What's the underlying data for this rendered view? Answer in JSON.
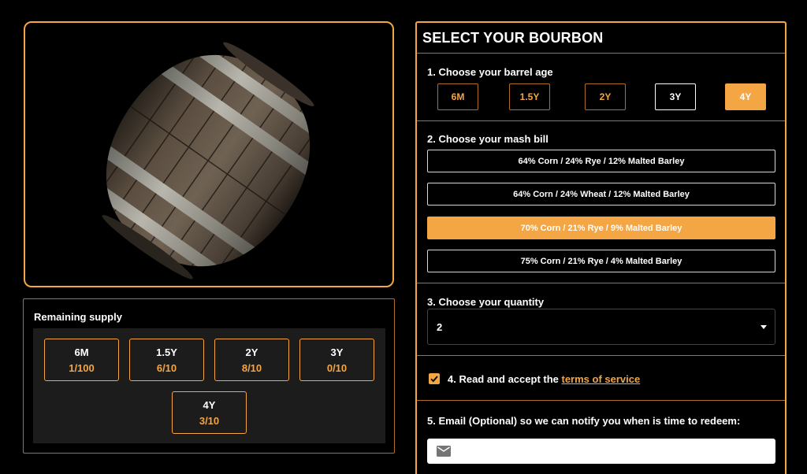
{
  "colors": {
    "accent": "#f4a544",
    "background": "#000000",
    "panel_inner": "#1c1c1c"
  },
  "supply": {
    "title": "Remaining supply",
    "items": [
      {
        "label": "6M",
        "value": "1/100"
      },
      {
        "label": "1.5Y",
        "value": "6/10"
      },
      {
        "label": "2Y",
        "value": "8/10"
      },
      {
        "label": "3Y",
        "value": "0/10"
      },
      {
        "label": "4Y",
        "value": "3/10"
      }
    ]
  },
  "selector": {
    "title": "SELECT YOUR BOURBON",
    "step1": {
      "label": "1. Choose your barrel age",
      "options": [
        "6M",
        "1.5Y",
        "2Y",
        "3Y",
        "4Y"
      ],
      "selected": "4Y"
    },
    "step2": {
      "label": "2. Choose your mash bill",
      "options": [
        "64% Corn / 24% Rye / 12% Malted Barley",
        "64% Corn / 24% Wheat / 12% Malted Barley",
        "70% Corn / 21% Rye / 9% Malted Barley",
        "75% Corn / 21% Rye / 4% Malted Barley"
      ],
      "selected": "70% Corn / 21% Rye / 9% Malted Barley"
    },
    "step3": {
      "label": "3. Choose your quantity",
      "value": "2"
    },
    "step4": {
      "prefix": "4. Read and accept the ",
      "link": "terms of service",
      "checked": true
    },
    "step5": {
      "label": "5. Email (Optional) so we can notify you when is time to redeem:",
      "placeholder": ""
    }
  },
  "icons": {
    "barrel": "barrel-image",
    "email": "mail-icon",
    "check": "check-icon",
    "dropdown": "chevron-down-icon"
  }
}
